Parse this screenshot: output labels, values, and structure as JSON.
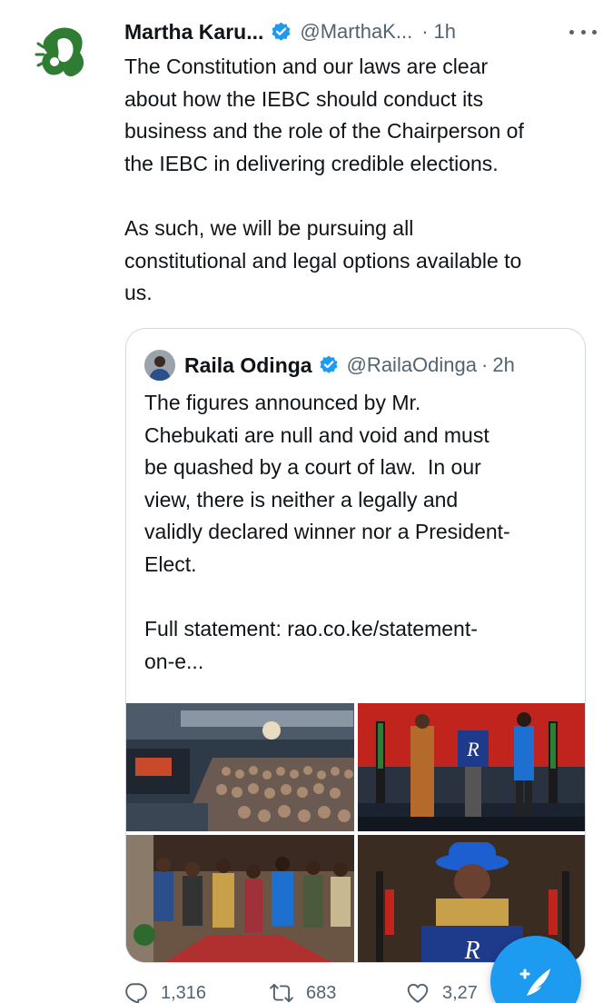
{
  "tweet": {
    "author_name": "Martha Karu...",
    "author_handle": "@MarthaK...",
    "time": "1h",
    "separator": "·",
    "text": "The Constitution and our laws are clear\nabout how the IEBC should conduct its\nbusiness and the role of the Chairperson of\nthe IEBC in delivering credible elections.\n\nAs such, we will be pursuing all\nconstitutional and legal options available to\nus."
  },
  "quoted_tweet": {
    "author_name": "Raila Odinga",
    "author_handle": "@RailaOdinga",
    "separator": "·",
    "time": "2h",
    "text": "The figures announced by Mr.\nChebukati are null and void and must\nbe quashed by a court of law.  In our\nview, there is neither a legally and\nvalidly declared winner nor a President-\nElect.\n\nFull statement: rao.co.ke/statement-\non-e...",
    "photos": [
      "photo-crowd-hall",
      "photo-podium-stage",
      "photo-walking-group",
      "photo-speaker-closeup"
    ]
  },
  "actions": {
    "reply_count": "1,316",
    "retweet_count": "683",
    "like_count": "3,27"
  },
  "icons": {
    "verified": "verified-badge-icon",
    "more": "more-options-icon",
    "reply": "reply-icon",
    "retweet": "retweet-icon",
    "like": "heart-icon",
    "compose": "compose-tweet-icon"
  },
  "colors": {
    "accent": "#1d9bf0",
    "secondary_text": "#536471",
    "primary_text": "#0f1419",
    "border": "#cfd9de",
    "logo_green": "#2e7d32"
  }
}
